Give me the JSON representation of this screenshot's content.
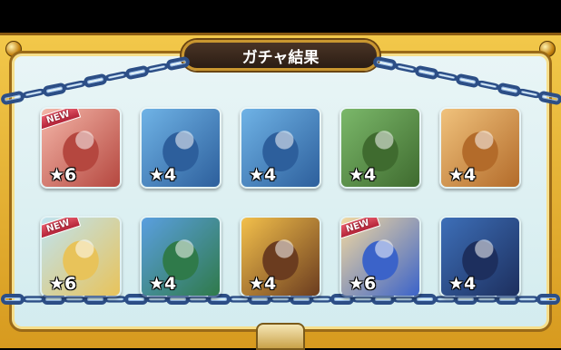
{
  "title": "ガチャ結果",
  "results": [
    {
      "stars": "★6",
      "is_new": true,
      "new_label": "NEW",
      "portrait": "pink-hair-girl-with-cat",
      "bg": "#f4b6a8",
      "accent": "#b5473f"
    },
    {
      "stars": "★4",
      "is_new": false,
      "portrait": "blue-water-dragon",
      "bg": "#6fb3e6",
      "accent": "#2d5f9c"
    },
    {
      "stars": "★4",
      "is_new": false,
      "portrait": "blue-water-dragon",
      "bg": "#6fb3e6",
      "accent": "#2d5f9c"
    },
    {
      "stars": "★4",
      "is_new": false,
      "portrait": "bandana-fighter-man",
      "bg": "#7bb86a",
      "accent": "#3f6b2f"
    },
    {
      "stars": "★4",
      "is_new": false,
      "portrait": "white-hair-girl-with-fur",
      "bg": "#f0c27c",
      "accent": "#b36b2a"
    },
    {
      "stars": "★6",
      "is_new": true,
      "new_label": "NEW",
      "portrait": "blonde-fairy-girl",
      "bg": "#bfe3f0",
      "accent": "#e8c35a"
    },
    {
      "stars": "★4",
      "is_new": false,
      "portrait": "green-crocodile",
      "bg": "#5a9fe0",
      "accent": "#2f7a4a"
    },
    {
      "stars": "★4",
      "is_new": false,
      "portrait": "curly-hair-man",
      "bg": "#f3c04b",
      "accent": "#6b3c1f"
    },
    {
      "stars": "★6",
      "is_new": true,
      "new_label": "NEW",
      "portrait": "blonde-girl-blue-bow",
      "bg": "#f3d9a0",
      "accent": "#3b63c9"
    },
    {
      "stars": "★4",
      "is_new": false,
      "portrait": "dark-blue-captain-girl",
      "bg": "#3d6fb8",
      "accent": "#1d2f5e"
    }
  ],
  "colors": {
    "frame": "#e4b43a",
    "chain": "#2c4e86",
    "panel": "#dff0f3",
    "title_plate": "#3a281c"
  }
}
